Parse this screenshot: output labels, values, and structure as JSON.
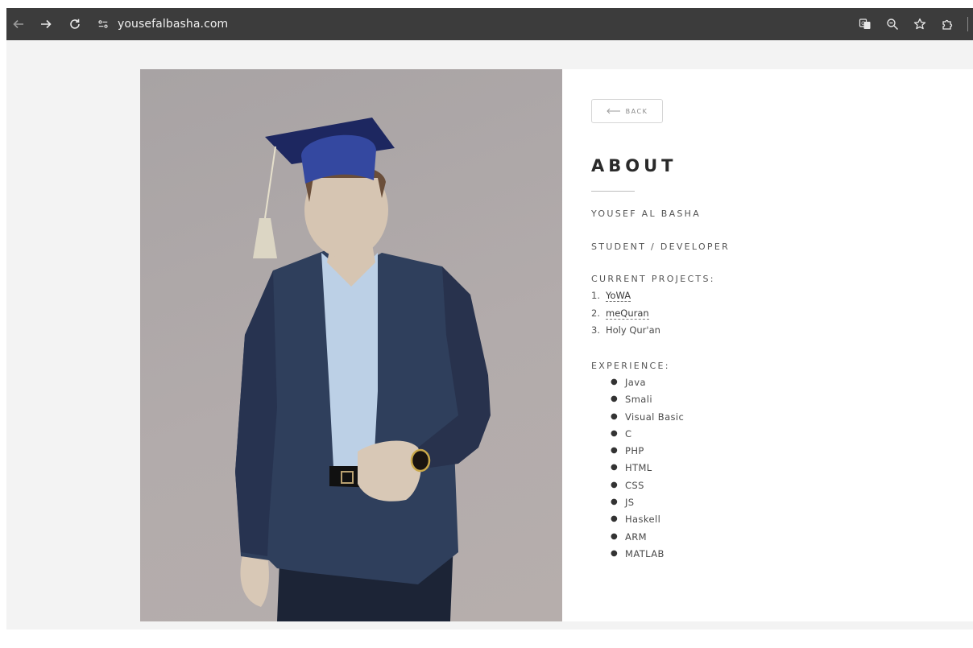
{
  "browser": {
    "url": "yousefalbasha.com"
  },
  "page": {
    "back_label": "BACK",
    "title": "ABOUT",
    "name": "YOUSEF AL BASHA",
    "role": "STUDENT / DEVELOPER",
    "projects_heading": "CURRENT PROJECTS:",
    "projects": [
      {
        "num": "1.",
        "label": "YoWA",
        "link": true
      },
      {
        "num": "2.",
        "label": "meQuran",
        "link": true
      },
      {
        "num": "3.",
        "label": "Holy Qur'an",
        "link": false
      }
    ],
    "experience_heading": "EXPERIENCE:",
    "experience": [
      "Java",
      "Smali",
      "Visual Basic",
      "C",
      "PHP",
      "HTML",
      "CSS",
      "JS",
      "Haskell",
      "ARM",
      "MATLAB"
    ]
  },
  "icons": {
    "back": "back-arrow-icon",
    "forward": "forward-arrow-icon",
    "reload": "reload-icon",
    "site_info": "site-info-icon",
    "translate": "translate-icon",
    "zoom": "zoom-icon",
    "bookmark": "star-icon",
    "extensions": "puzzle-icon"
  },
  "colors": {
    "toolbar": "#3c3c3c",
    "page_bg": "#f3f3f3",
    "cap": "#3448a0",
    "jacket": "#2f3f5c",
    "shirt": "#bcd0e6"
  }
}
